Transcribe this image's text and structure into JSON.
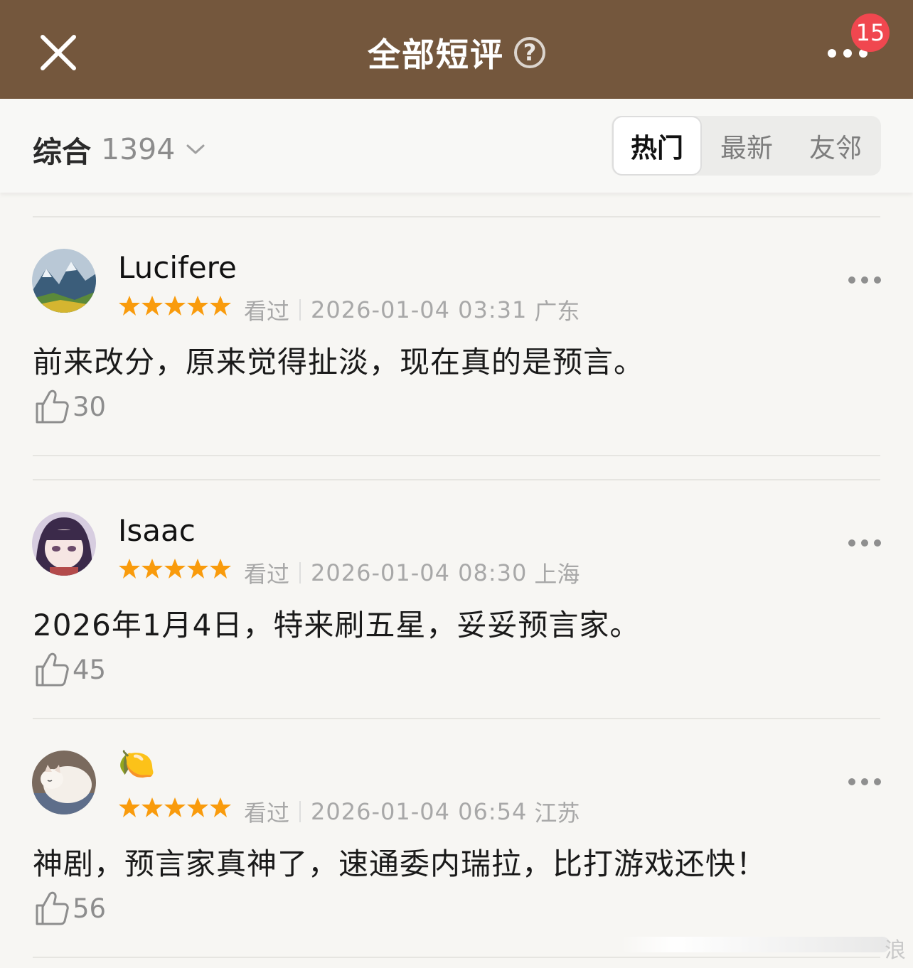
{
  "header": {
    "title": "全部短评",
    "help_glyph": "?",
    "notification_count": "15"
  },
  "filter": {
    "sort_label": "综合",
    "sort_count": "1394",
    "tabs": [
      {
        "label": "热门",
        "active": true
      },
      {
        "label": "最新",
        "active": false
      },
      {
        "label": "友邻",
        "active": false
      }
    ]
  },
  "comments": [
    {
      "user": "Lucifere",
      "rating": 5,
      "status": "看过",
      "datetime": "2026-01-04 03:31",
      "location": "广东",
      "text": "前来改分，原来觉得扯淡，现在真的是预言。",
      "likes": "30",
      "avatar": "mountain-landscape-avatar"
    },
    {
      "user": "Isaac",
      "rating": 5,
      "status": "看过",
      "datetime": "2026-01-04 08:30",
      "location": "上海",
      "text": "2026年1月4日，特来刷五星，妥妥预言家。",
      "likes": "45",
      "avatar": "anime-girl-avatar"
    },
    {
      "user": "🍋",
      "rating": 5,
      "status": "看过",
      "datetime": "2026-01-04 06:54",
      "location": "江苏",
      "text": "神剧，预言家真神了，速通委内瑞拉，比打游戏还快！",
      "likes": "56",
      "avatar": "sleeping-cat-avatar"
    }
  ],
  "watermark_char": "浪",
  "colors": {
    "header_bg": "#74573d",
    "badge": "#f0474f",
    "star": "#f99b0c",
    "page_bg": "#f7f6f3"
  }
}
